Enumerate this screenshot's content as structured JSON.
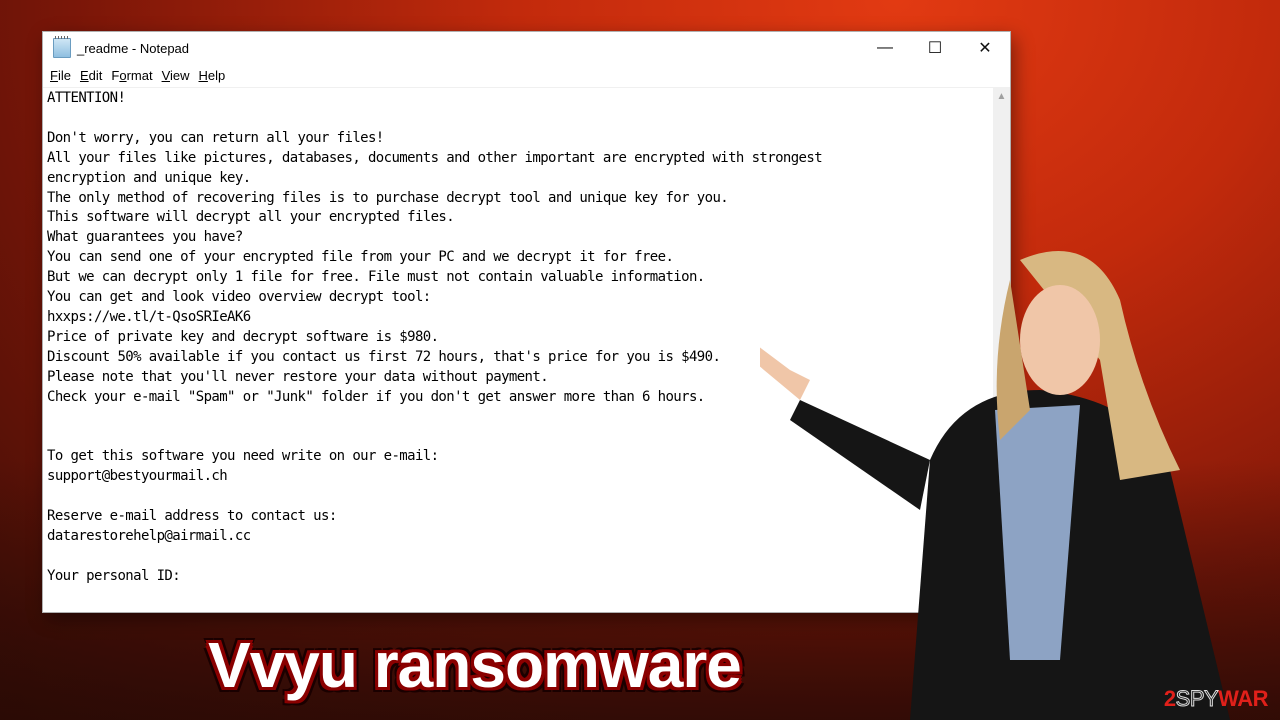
{
  "window": {
    "title": "_readme - Notepad",
    "icon": "notepad-icon",
    "controls": {
      "minimize": "—",
      "maximize": "☐",
      "close": "✕"
    }
  },
  "menu": [
    {
      "key": "F",
      "rest": "ile"
    },
    {
      "key": "E",
      "rest": "dit"
    },
    {
      "pre": "F",
      "key": "o",
      "rest": "rmat"
    },
    {
      "key": "V",
      "rest": "iew"
    },
    {
      "key": "H",
      "rest": "elp"
    }
  ],
  "note_lines": [
    "ATTENTION!",
    "",
    "Don't worry, you can return all your files!",
    "All your files like pictures, databases, documents and other important are encrypted with strongest",
    "encryption and unique key.",
    "The only method of recovering files is to purchase decrypt tool and unique key for you.",
    "This software will decrypt all your encrypted files.",
    "What guarantees you have?",
    "You can send one of your encrypted file from your PC and we decrypt it for free.",
    "But we can decrypt only 1 file for free. File must not contain valuable information.",
    "You can get and look video overview decrypt tool:",
    "hxxps://we.tl/t-QsoSRIeAK6",
    "Price of private key and decrypt software is $980.",
    "Discount 50% available if you contact us first 72 hours, that's price for you is $490.",
    "Please note that you'll never restore your data without payment.",
    "Check your e-mail \"Spam\" or \"Junk\" folder if you don't get answer more than 6 hours.",
    "",
    "",
    "To get this software you need write on our e-mail:",
    "support@bestyourmail.ch",
    "",
    "Reserve e-mail address to contact us:",
    "datarestorehelp@airmail.cc",
    "",
    "Your personal ID:"
  ],
  "headline": "Vvyu ransomware",
  "logo": {
    "two": "2",
    "spy": "SPY",
    "war": "WAR"
  },
  "colors": {
    "accent": "#e0201a",
    "background": "#c22a0c"
  }
}
